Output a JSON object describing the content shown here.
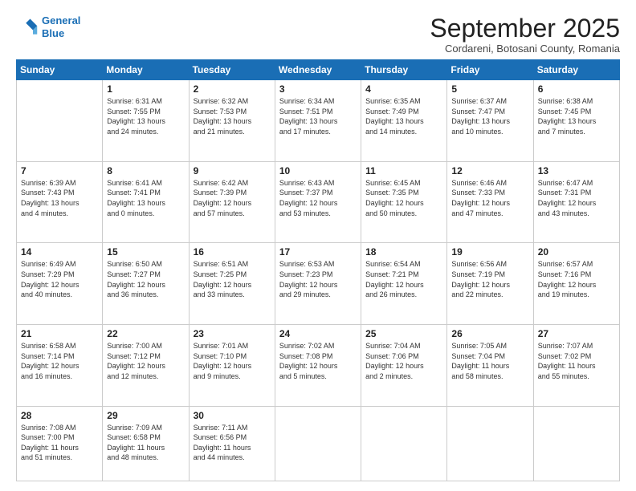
{
  "header": {
    "logo_line1": "General",
    "logo_line2": "Blue",
    "month": "September 2025",
    "location": "Cordareni, Botosani County, Romania"
  },
  "weekdays": [
    "Sunday",
    "Monday",
    "Tuesday",
    "Wednesday",
    "Thursday",
    "Friday",
    "Saturday"
  ],
  "weeks": [
    [
      {
        "day": "",
        "text": ""
      },
      {
        "day": "1",
        "text": "Sunrise: 6:31 AM\nSunset: 7:55 PM\nDaylight: 13 hours\nand 24 minutes."
      },
      {
        "day": "2",
        "text": "Sunrise: 6:32 AM\nSunset: 7:53 PM\nDaylight: 13 hours\nand 21 minutes."
      },
      {
        "day": "3",
        "text": "Sunrise: 6:34 AM\nSunset: 7:51 PM\nDaylight: 13 hours\nand 17 minutes."
      },
      {
        "day": "4",
        "text": "Sunrise: 6:35 AM\nSunset: 7:49 PM\nDaylight: 13 hours\nand 14 minutes."
      },
      {
        "day": "5",
        "text": "Sunrise: 6:37 AM\nSunset: 7:47 PM\nDaylight: 13 hours\nand 10 minutes."
      },
      {
        "day": "6",
        "text": "Sunrise: 6:38 AM\nSunset: 7:45 PM\nDaylight: 13 hours\nand 7 minutes."
      }
    ],
    [
      {
        "day": "7",
        "text": "Sunrise: 6:39 AM\nSunset: 7:43 PM\nDaylight: 13 hours\nand 4 minutes."
      },
      {
        "day": "8",
        "text": "Sunrise: 6:41 AM\nSunset: 7:41 PM\nDaylight: 13 hours\nand 0 minutes."
      },
      {
        "day": "9",
        "text": "Sunrise: 6:42 AM\nSunset: 7:39 PM\nDaylight: 12 hours\nand 57 minutes."
      },
      {
        "day": "10",
        "text": "Sunrise: 6:43 AM\nSunset: 7:37 PM\nDaylight: 12 hours\nand 53 minutes."
      },
      {
        "day": "11",
        "text": "Sunrise: 6:45 AM\nSunset: 7:35 PM\nDaylight: 12 hours\nand 50 minutes."
      },
      {
        "day": "12",
        "text": "Sunrise: 6:46 AM\nSunset: 7:33 PM\nDaylight: 12 hours\nand 47 minutes."
      },
      {
        "day": "13",
        "text": "Sunrise: 6:47 AM\nSunset: 7:31 PM\nDaylight: 12 hours\nand 43 minutes."
      }
    ],
    [
      {
        "day": "14",
        "text": "Sunrise: 6:49 AM\nSunset: 7:29 PM\nDaylight: 12 hours\nand 40 minutes."
      },
      {
        "day": "15",
        "text": "Sunrise: 6:50 AM\nSunset: 7:27 PM\nDaylight: 12 hours\nand 36 minutes."
      },
      {
        "day": "16",
        "text": "Sunrise: 6:51 AM\nSunset: 7:25 PM\nDaylight: 12 hours\nand 33 minutes."
      },
      {
        "day": "17",
        "text": "Sunrise: 6:53 AM\nSunset: 7:23 PM\nDaylight: 12 hours\nand 29 minutes."
      },
      {
        "day": "18",
        "text": "Sunrise: 6:54 AM\nSunset: 7:21 PM\nDaylight: 12 hours\nand 26 minutes."
      },
      {
        "day": "19",
        "text": "Sunrise: 6:56 AM\nSunset: 7:19 PM\nDaylight: 12 hours\nand 22 minutes."
      },
      {
        "day": "20",
        "text": "Sunrise: 6:57 AM\nSunset: 7:16 PM\nDaylight: 12 hours\nand 19 minutes."
      }
    ],
    [
      {
        "day": "21",
        "text": "Sunrise: 6:58 AM\nSunset: 7:14 PM\nDaylight: 12 hours\nand 16 minutes."
      },
      {
        "day": "22",
        "text": "Sunrise: 7:00 AM\nSunset: 7:12 PM\nDaylight: 12 hours\nand 12 minutes."
      },
      {
        "day": "23",
        "text": "Sunrise: 7:01 AM\nSunset: 7:10 PM\nDaylight: 12 hours\nand 9 minutes."
      },
      {
        "day": "24",
        "text": "Sunrise: 7:02 AM\nSunset: 7:08 PM\nDaylight: 12 hours\nand 5 minutes."
      },
      {
        "day": "25",
        "text": "Sunrise: 7:04 AM\nSunset: 7:06 PM\nDaylight: 12 hours\nand 2 minutes."
      },
      {
        "day": "26",
        "text": "Sunrise: 7:05 AM\nSunset: 7:04 PM\nDaylight: 11 hours\nand 58 minutes."
      },
      {
        "day": "27",
        "text": "Sunrise: 7:07 AM\nSunset: 7:02 PM\nDaylight: 11 hours\nand 55 minutes."
      }
    ],
    [
      {
        "day": "28",
        "text": "Sunrise: 7:08 AM\nSunset: 7:00 PM\nDaylight: 11 hours\nand 51 minutes."
      },
      {
        "day": "29",
        "text": "Sunrise: 7:09 AM\nSunset: 6:58 PM\nDaylight: 11 hours\nand 48 minutes."
      },
      {
        "day": "30",
        "text": "Sunrise: 7:11 AM\nSunset: 6:56 PM\nDaylight: 11 hours\nand 44 minutes."
      },
      {
        "day": "",
        "text": ""
      },
      {
        "day": "",
        "text": ""
      },
      {
        "day": "",
        "text": ""
      },
      {
        "day": "",
        "text": ""
      }
    ]
  ]
}
